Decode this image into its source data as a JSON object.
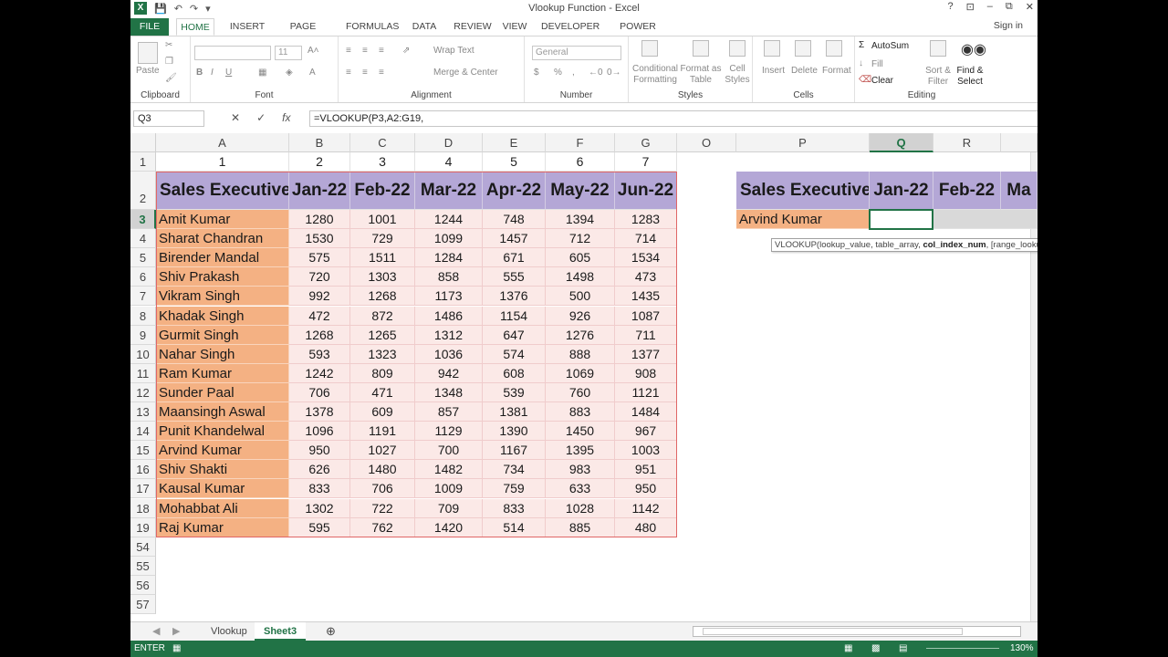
{
  "app": {
    "title": "Vlookup Function - Excel",
    "logo": "X",
    "sign_in": "Sign in"
  },
  "window_controls": [
    "?",
    "⊡",
    "–",
    "⧉",
    "✕"
  ],
  "tabs": [
    "FILE",
    "HOME",
    "INSERT",
    "PAGE LAYOUT",
    "FORMULAS",
    "DATA",
    "REVIEW",
    "VIEW",
    "DEVELOPER",
    "POWER QUERY"
  ],
  "ribbon": {
    "groups": [
      "Clipboard",
      "Font",
      "Alignment",
      "Number",
      "Styles",
      "Cells",
      "Editing"
    ],
    "paste": "Paste",
    "font_size": "11",
    "wrap_text": "Wrap Text",
    "merge_center": "Merge & Center",
    "number_format": "General",
    "conditional": "Conditional Formatting",
    "format_table": "Format as Table",
    "cell_styles": "Cell Styles",
    "insert": "Insert",
    "delete": "Delete",
    "format": "Format",
    "autosum": "AutoSum",
    "fill": "Fill",
    "clear": "Clear",
    "sort_filter": "Sort & Filter",
    "find_select": "Find & Select"
  },
  "formula_bar": {
    "name_box": "Q3",
    "formula": "=VLOOKUP(P3,A2:G19,"
  },
  "columns": [
    "A",
    "B",
    "C",
    "D",
    "E",
    "F",
    "G",
    "O",
    "P",
    "Q",
    "R"
  ],
  "row1_numbers": [
    "1",
    "2",
    "3",
    "4",
    "5",
    "6",
    "7"
  ],
  "headers": [
    "Sales Executive",
    "Jan-22",
    "Feb-22",
    "Mar-22",
    "Apr-22",
    "May-22",
    "Jun-22"
  ],
  "rows": [
    {
      "num": "3",
      "name": "Amit Kumar",
      "values": [
        "1280",
        "1001",
        "1244",
        "748",
        "1394",
        "1283"
      ]
    },
    {
      "num": "4",
      "name": "Sharat Chandran",
      "values": [
        "1530",
        "729",
        "1099",
        "1457",
        "712",
        "714"
      ]
    },
    {
      "num": "5",
      "name": "Birender Mandal",
      "values": [
        "575",
        "1511",
        "1284",
        "671",
        "605",
        "1534"
      ]
    },
    {
      "num": "6",
      "name": "Shiv Prakash",
      "values": [
        "720",
        "1303",
        "858",
        "555",
        "1498",
        "473"
      ]
    },
    {
      "num": "7",
      "name": "Vikram Singh",
      "values": [
        "992",
        "1268",
        "1173",
        "1376",
        "500",
        "1435"
      ]
    },
    {
      "num": "8",
      "name": "Khadak Singh",
      "values": [
        "472",
        "872",
        "1486",
        "1154",
        "926",
        "1087"
      ]
    },
    {
      "num": "9",
      "name": "Gurmit Singh",
      "values": [
        "1268",
        "1265",
        "1312",
        "647",
        "1276",
        "711"
      ]
    },
    {
      "num": "10",
      "name": "Nahar Singh",
      "values": [
        "593",
        "1323",
        "1036",
        "574",
        "888",
        "1377"
      ]
    },
    {
      "num": "11",
      "name": "Ram Kumar",
      "values": [
        "1242",
        "809",
        "942",
        "608",
        "1069",
        "908"
      ]
    },
    {
      "num": "12",
      "name": "Sunder Paal",
      "values": [
        "706",
        "471",
        "1348",
        "539",
        "760",
        "1121"
      ]
    },
    {
      "num": "13",
      "name": "Maansingh Aswal",
      "values": [
        "1378",
        "609",
        "857",
        "1381",
        "883",
        "1484"
      ]
    },
    {
      "num": "14",
      "name": "Punit Khandelwal",
      "values": [
        "1096",
        "1191",
        "1129",
        "1390",
        "1450",
        "967"
      ]
    },
    {
      "num": "15",
      "name": "Arvind Kumar",
      "values": [
        "950",
        "1027",
        "700",
        "1167",
        "1395",
        "1003"
      ]
    },
    {
      "num": "16",
      "name": "Shiv Shakti",
      "values": [
        "626",
        "1480",
        "1482",
        "734",
        "983",
        "951"
      ]
    },
    {
      "num": "17",
      "name": "Kausal Kumar",
      "values": [
        "833",
        "706",
        "1009",
        "759",
        "633",
        "950"
      ]
    },
    {
      "num": "18",
      "name": "Mohabbat Ali",
      "values": [
        "1302",
        "722",
        "709",
        "833",
        "1028",
        "1142"
      ]
    },
    {
      "num": "19",
      "name": "Raj Kumar",
      "values": [
        "595",
        "762",
        "1420",
        "514",
        "885",
        "480"
      ]
    }
  ],
  "extra_rows": [
    "54",
    "55",
    "56",
    "57"
  ],
  "lookup": {
    "headers": [
      "Sales Executive",
      "Jan-22",
      "Feb-22",
      "Ma"
    ],
    "name": "Arvind Kumar"
  },
  "tooltip": {
    "before": "VLOOKUP(lookup_value, table_array, ",
    "bold": "col_index_num",
    "after": ", [range_lookup])"
  },
  "sheets": [
    "Vlookup",
    "Sheet3"
  ],
  "status": "ENTER",
  "zoom": "130%",
  "colors": {
    "excel_green": "#217346",
    "header_purple": "#b4a7d6",
    "name_orange": "#f4b183",
    "value_pink": "#fbe9e7"
  }
}
